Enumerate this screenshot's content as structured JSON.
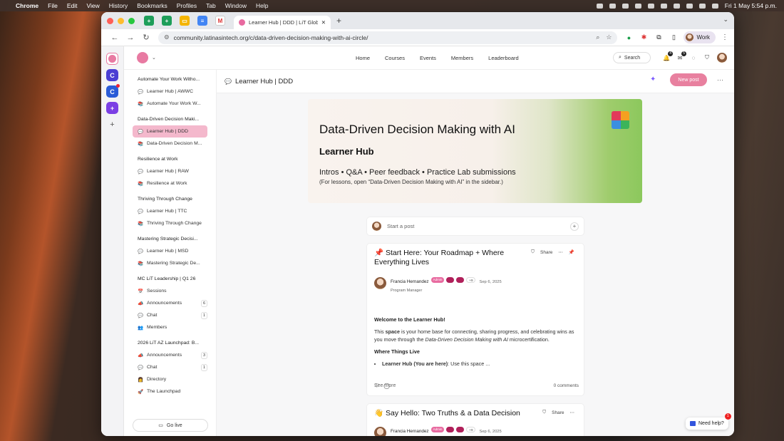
{
  "menubar": {
    "apple": "",
    "app": "Chrome",
    "items": [
      "File",
      "Edit",
      "View",
      "History",
      "Bookmarks",
      "Profiles",
      "Tab",
      "Window",
      "Help"
    ],
    "datetime": "Fri 1 May  5:54 p.m."
  },
  "browser": {
    "tab_title": "Learner Hub | DDD | LiT Glob...",
    "url": "community.latinasintech.org/c/data-driven-decision-making-with-ai-circle/",
    "profile": "Work"
  },
  "rail": {
    "items": [
      {
        "letter": "C",
        "color": "#4b3fd3"
      },
      {
        "letter": "C",
        "color": "#2a5bd7"
      },
      {
        "letter": "+",
        "color": "#7b3fe4"
      }
    ]
  },
  "nav": {
    "links": [
      "Home",
      "Courses",
      "Events",
      "Members",
      "Leaderboard"
    ],
    "search": "Search",
    "badge1": "4",
    "badge2": "5"
  },
  "sidebar": {
    "sections": [
      {
        "title": "Automate Your Work Witho...",
        "items": [
          {
            "label": "Learner Hub | AWWC",
            "icon": "💬"
          },
          {
            "label": "Automate Your Work W...",
            "icon": "📚"
          }
        ]
      },
      {
        "title": "Data-Driven Decision Maki...",
        "items": [
          {
            "label": "Learner Hub | DDD",
            "icon": "💬",
            "active": true
          },
          {
            "label": "Data-Driven Decision M...",
            "icon": "📚"
          }
        ]
      },
      {
        "title": "Resilience at Work",
        "items": [
          {
            "label": "Learner Hub | RAW",
            "icon": "💬"
          },
          {
            "label": "Resilience at Work",
            "icon": "📚"
          }
        ]
      },
      {
        "title": "Thriving Through Change",
        "items": [
          {
            "label": "Learner Hub | TTC",
            "icon": "💬"
          },
          {
            "label": "Thriving Through Change",
            "icon": "📚"
          }
        ]
      },
      {
        "title": "Mastering Strategic Decisi...",
        "items": [
          {
            "label": "Learner Hub | MSD",
            "icon": "💬"
          },
          {
            "label": "Mastering Strategic De...",
            "icon": "📚"
          }
        ]
      },
      {
        "title": "MC LiT Leadership | Q1 26",
        "items": [
          {
            "label": "Sessions",
            "icon": "📅"
          },
          {
            "label": "Announcements",
            "icon": "📣",
            "count": "6"
          },
          {
            "label": "Chat",
            "icon": "💬",
            "count": "1"
          },
          {
            "label": "Members",
            "icon": "👥"
          }
        ]
      },
      {
        "title": "2026 LiT AZ Launchpad: B...",
        "items": [
          {
            "label": "Announcements",
            "icon": "📣",
            "count": "3"
          },
          {
            "label": "Chat",
            "icon": "💬",
            "count": "1"
          },
          {
            "label": "Directory",
            "icon": "👩"
          },
          {
            "label": "The Launchpad",
            "icon": "🚀"
          }
        ]
      }
    ],
    "go_live": "Go live"
  },
  "main": {
    "title": "Learner Hub | DDD",
    "new_post": "New post"
  },
  "banner": {
    "title": "Data-Driven Decision Making with AI",
    "subtitle": "Learner Hub",
    "line1": "Intros • Q&A • Peer feedback • Practice Lab submissions",
    "line2": "(For lessons, open “Data-Driven Decision Making with AI” in the sidebar.)"
  },
  "composer": {
    "placeholder": "Start a post"
  },
  "post1": {
    "title": "📌 Start Here: Your Roadmap + Where Everything Lives",
    "share": "Share",
    "author": "Francia Hernandez",
    "role": "Program Manager",
    "tag_admin": "Admin",
    "tag_plus": "+9",
    "date": "Sep 6, 2025",
    "welcome": "Welcome to the Learner Hub!",
    "p_pre": "This ",
    "p_bold": "space",
    "p_mid": " is your home base for connecting, sharing progress, and celebrating wins as you move through the ",
    "p_italic": "Data-Driven Decision Making with AI",
    "p_post": " microcertification.",
    "where": "Where Things Live",
    "li_bold": "Learner Hub (You are here)",
    "li_rest": ": Use this space ...",
    "see_more": "See more",
    "comments": "0 comments"
  },
  "post2": {
    "title": "👋 Say Hello: Two Truths & a Data Decision",
    "share": "Share",
    "author": "Francia Hernandez",
    "role": "Program Manager",
    "tag_admin": "Admin",
    "tag_plus": "+9",
    "date": "Sep 6, 2025"
  },
  "help": {
    "label": "Need help?",
    "badge": "1"
  }
}
